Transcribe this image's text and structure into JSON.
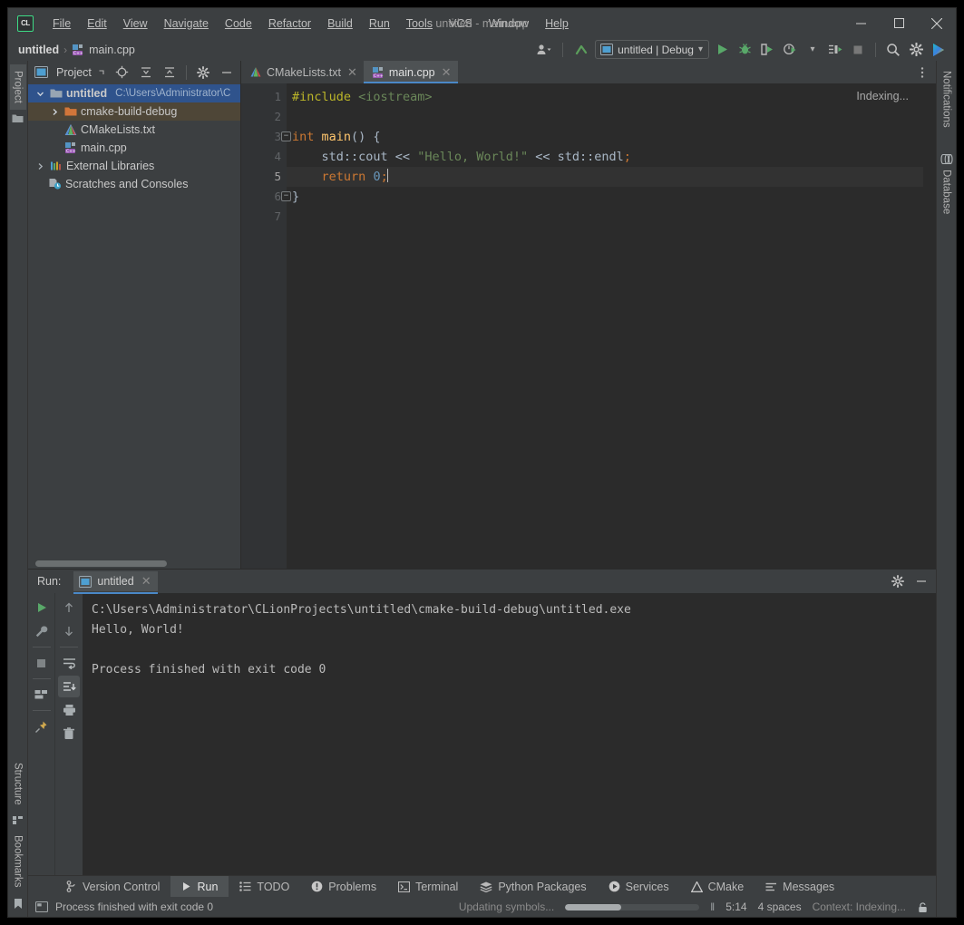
{
  "window": {
    "title": "untitled - main.cpp",
    "logo_text": "CL",
    "minimize": "—",
    "maximize": "☐",
    "close": "✕"
  },
  "menu": {
    "items": [
      {
        "label": "File"
      },
      {
        "label": "Edit"
      },
      {
        "label": "View"
      },
      {
        "label": "Navigate"
      },
      {
        "label": "Code"
      },
      {
        "label": "Refactor"
      },
      {
        "label": "Build"
      },
      {
        "label": "Run"
      },
      {
        "label": "Tools"
      },
      {
        "label": "VCS"
      },
      {
        "label": "Window"
      },
      {
        "label": "Help"
      }
    ]
  },
  "toolbar": {
    "breadcrumb_project": "untitled",
    "breadcrumb_sep": "›",
    "breadcrumb_file": "main.cpp",
    "run_config": "untitled | Debug",
    "dropdown_caret": "▾",
    "icons": {
      "account": "account-icon",
      "update": "update-project-icon",
      "run": "run-icon",
      "debug": "debug-icon",
      "run_coverage": "run-with-coverage-icon",
      "profile": "profile-icon",
      "attach": "attach-process-icon",
      "stop": "stop-icon",
      "search": "search-icon",
      "settings": "gear-icon",
      "ide_features": "ide-features-trainer-icon"
    }
  },
  "left_rail": {
    "top": [
      {
        "label": "Project",
        "active": true
      }
    ],
    "bottom": [
      {
        "label": "Structure"
      },
      {
        "label": "Bookmarks"
      }
    ]
  },
  "right_rail": {
    "items": [
      {
        "label": "Notifications"
      },
      {
        "label": "Database"
      }
    ]
  },
  "project_panel": {
    "title": "Project",
    "tree": [
      {
        "label": "untitled",
        "path": "C:\\Users\\Administrator\\C",
        "icon": "folder-icon",
        "arrow": "⌄",
        "indent": 0,
        "state": "selected-blue"
      },
      {
        "label": "cmake-build-debug",
        "path": "",
        "icon": "folder-orange-icon",
        "arrow": "›",
        "indent": 1,
        "state": "selected-amber"
      },
      {
        "label": "CMakeLists.txt",
        "path": "",
        "icon": "cmake-icon",
        "arrow": "",
        "indent": 2,
        "state": ""
      },
      {
        "label": "main.cpp",
        "path": "",
        "icon": "cpp-file-icon",
        "arrow": "",
        "indent": 2,
        "state": ""
      },
      {
        "label": "External Libraries",
        "path": "",
        "icon": "libraries-icon",
        "arrow": "›",
        "indent": 0,
        "state": ""
      },
      {
        "label": "Scratches and Consoles",
        "path": "",
        "icon": "scratches-icon",
        "arrow": "",
        "indent": 1,
        "state": ""
      }
    ]
  },
  "editor": {
    "tabs": [
      {
        "label": "CMakeLists.txt",
        "icon": "cmake-icon",
        "active": false
      },
      {
        "label": "main.cpp",
        "icon": "cpp-file-icon",
        "active": true
      }
    ],
    "close_glyph": "✕",
    "status_right": "Indexing...",
    "line_numbers": [
      "1",
      "2",
      "3",
      "4",
      "5",
      "6",
      "7"
    ],
    "current_line": 5,
    "lines": [
      {
        "n": 1,
        "tokens": [
          {
            "t": "#include",
            "c": "k-pre"
          },
          {
            "t": " ",
            "c": "k-txt"
          },
          {
            "t": "<iostream>",
            "c": "k-inc"
          }
        ]
      },
      {
        "n": 2,
        "tokens": []
      },
      {
        "n": 3,
        "tokens": [
          {
            "t": "int",
            "c": "k-kw"
          },
          {
            "t": " ",
            "c": "k-txt"
          },
          {
            "t": "main",
            "c": "k-fn"
          },
          {
            "t": "() {",
            "c": "k-txt"
          }
        ]
      },
      {
        "n": 4,
        "tokens": [
          {
            "t": "    std::cout ",
            "c": "k-txt"
          },
          {
            "t": "<<",
            "c": "k-txt"
          },
          {
            "t": " \"Hello, World!\"",
            "c": "k-str"
          },
          {
            "t": " << ",
            "c": "k-txt"
          },
          {
            "t": "std::endl",
            "c": "k-txt"
          },
          {
            "t": ";",
            "c": "k-kw"
          }
        ]
      },
      {
        "n": 5,
        "tokens": [
          {
            "t": "    ",
            "c": "k-txt"
          },
          {
            "t": "return",
            "c": "k-kw"
          },
          {
            "t": " ",
            "c": "k-txt"
          },
          {
            "t": "0",
            "c": "k-num"
          },
          {
            "t": ";",
            "c": "k-kw"
          }
        ]
      },
      {
        "n": 6,
        "tokens": [
          {
            "t": "}",
            "c": "k-txt"
          }
        ]
      },
      {
        "n": 7,
        "tokens": []
      }
    ]
  },
  "run_panel": {
    "label": "Run:",
    "tab_label": "untitled",
    "close_glyph": "✕",
    "console_lines": [
      "C:\\Users\\Administrator\\CLionProjects\\untitled\\cmake-build-debug\\untitled.exe",
      "Hello, World!",
      "",
      "Process finished with exit code 0"
    ],
    "tool_icons": {
      "rerun": "rerun-icon",
      "settings_wrench": "wrench-icon",
      "stop": "stop-icon",
      "layout": "layout-icon",
      "pin": "pin-icon",
      "up": "arrow-up-icon",
      "down": "arrow-down-icon",
      "soft_wrap": "soft-wrap-icon",
      "scroll_end": "scroll-to-end-icon",
      "print": "print-icon",
      "clear": "trash-icon"
    },
    "header_icons": {
      "settings": "gear-icon",
      "hide": "minimize-icon"
    }
  },
  "bottom_strip": {
    "items": [
      {
        "label": "Version Control",
        "icon": "branch-icon",
        "active": false
      },
      {
        "label": "Run",
        "icon": "run-icon",
        "active": true
      },
      {
        "label": "TODO",
        "icon": "todo-icon",
        "active": false
      },
      {
        "label": "Problems",
        "icon": "problems-icon",
        "active": false
      },
      {
        "label": "Terminal",
        "icon": "terminal-icon",
        "active": false
      },
      {
        "label": "Python Packages",
        "icon": "packages-icon",
        "active": false
      },
      {
        "label": "Services",
        "icon": "services-icon",
        "active": false
      },
      {
        "label": "CMake",
        "icon": "cmake-icon",
        "active": false
      },
      {
        "label": "Messages",
        "icon": "messages-icon",
        "active": false
      }
    ]
  },
  "status_bar": {
    "message": "Process finished with exit code 0",
    "progress_text": "Updating symbols...",
    "progress_percent": 42,
    "pause_glyph": "‖",
    "caret_position": "5:14",
    "indent": "4 spaces",
    "context": "Context: Indexing...",
    "lock_icon": "lock-icon",
    "console_icon": "console-icon"
  },
  "colors": {
    "bg_panel": "#3c3f41",
    "bg_editor": "#2b2b2b",
    "accent_blue": "#4a88c7",
    "selection_blue": "#2f538c",
    "selection_amber": "#4e4637",
    "green_run": "#59a869",
    "string_green": "#6a8759",
    "keyword_orange": "#cc7832",
    "function_yellow": "#ffc66d",
    "number_blue": "#6897bb",
    "preproc_yellow": "#bbb529"
  }
}
